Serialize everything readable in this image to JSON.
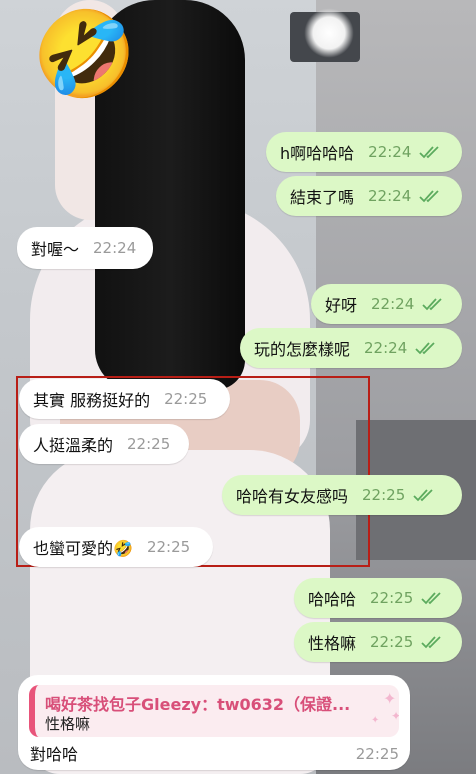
{
  "sticker": {
    "emoji": "🤣",
    "name": "rolling-laughing-face"
  },
  "messages": [
    {
      "dir": "out",
      "text": "h啊哈哈哈",
      "time": "22:24"
    },
    {
      "dir": "out",
      "text": "結束了嗎",
      "time": "22:24"
    },
    {
      "dir": "in",
      "text": "對喔～",
      "time": "22:24"
    },
    {
      "dir": "out",
      "text": "好呀",
      "time": "22:24"
    },
    {
      "dir": "out",
      "text": "玩的怎麼樣呢",
      "time": "22:24"
    },
    {
      "dir": "in",
      "text": "其實 服務挺好的",
      "time": "22:25"
    },
    {
      "dir": "in",
      "text": "人挺溫柔的",
      "time": "22:25"
    },
    {
      "dir": "out",
      "text": "哈哈有女友感吗",
      "time": "22:25"
    },
    {
      "dir": "in",
      "text": "也蠻可愛的🤣",
      "time": "22:25"
    },
    {
      "dir": "out",
      "text": "哈哈哈",
      "time": "22:25"
    },
    {
      "dir": "out",
      "text": "性格嘛",
      "time": "22:25"
    }
  ],
  "reply": {
    "quoted_name": "喝好茶找包子Gleezy：tw0632（保證...",
    "quoted_text": "性格嘛",
    "text": "對哈哈",
    "time": "22:25"
  },
  "colors": {
    "outgoing_bubble": "#dcf8c6",
    "incoming_bubble": "#ffffff",
    "read_check": "#5cab5e",
    "highlight_box": "#b81e16",
    "quote_accent": "#e8547a"
  }
}
